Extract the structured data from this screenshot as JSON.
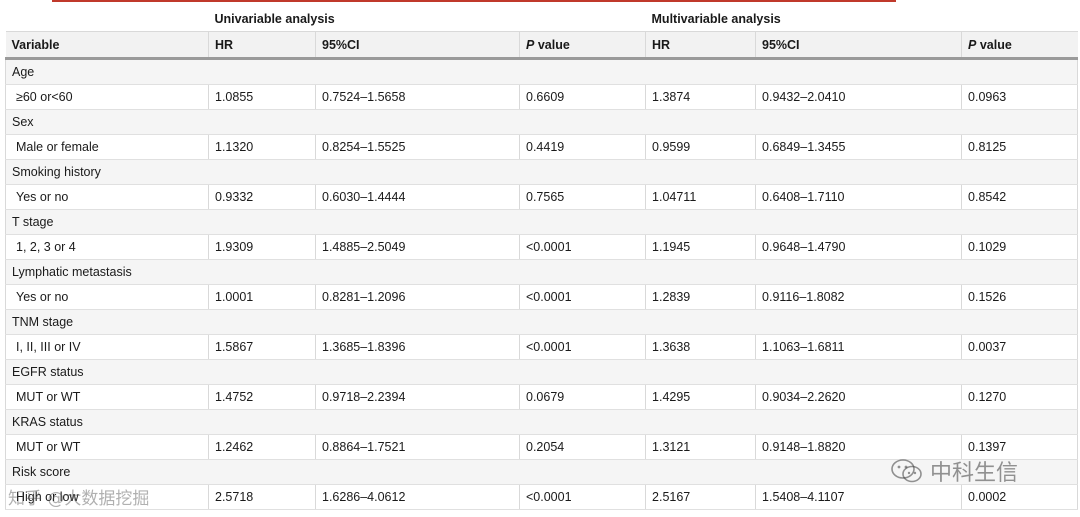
{
  "table": {
    "groups": {
      "univariable": "Univariable analysis",
      "multivariable": "Multivariable analysis"
    },
    "columns": {
      "variable": "Variable",
      "hr1": "HR",
      "ci1": "95%CI",
      "p1": "value",
      "hr2": "HR",
      "ci2": "95%CI",
      "p2": "value",
      "p_italic": "P"
    },
    "rows": [
      {
        "variable": "Age",
        "level": "≥60 or<60",
        "uni_hr": "1.0855",
        "uni_ci": "0.7524–1.5658",
        "uni_p": "0.6609",
        "multi_hr": "1.3874",
        "multi_ci": "0.9432–2.0410",
        "multi_p": "0.0963"
      },
      {
        "variable": "Sex",
        "level": "Male or female",
        "uni_hr": "1.1320",
        "uni_ci": "0.8254–1.5525",
        "uni_p": "0.4419",
        "multi_hr": "0.9599",
        "multi_ci": "0.6849–1.3455",
        "multi_p": "0.8125"
      },
      {
        "variable": "Smoking history",
        "level": "Yes or no",
        "uni_hr": "0.9332",
        "uni_ci": "0.6030–1.4444",
        "uni_p": "0.7565",
        "multi_hr": "1.04711",
        "multi_ci": "0.6408–1.7110",
        "multi_p": "0.8542"
      },
      {
        "variable": "T stage",
        "level": "1, 2, 3 or 4",
        "uni_hr": "1.9309",
        "uni_ci": "1.4885–2.5049",
        "uni_p": "<0.0001",
        "multi_hr": "1.1945",
        "multi_ci": "0.9648–1.4790",
        "multi_p": "0.1029"
      },
      {
        "variable": "Lymphatic metastasis",
        "level": "Yes or no",
        "uni_hr": "1.0001",
        "uni_ci": "0.8281–1.2096",
        "uni_p": "<0.0001",
        "multi_hr": "1.2839",
        "multi_ci": "0.9116–1.8082",
        "multi_p": "0.1526"
      },
      {
        "variable": "TNM stage",
        "level": "I, II, III or IV",
        "uni_hr": "1.5867",
        "uni_ci": "1.3685–1.8396",
        "uni_p": "<0.0001",
        "multi_hr": "1.3638",
        "multi_ci": "1.1063–1.6811",
        "multi_p": "0.0037"
      },
      {
        "variable": "EGFR status",
        "level": "MUT or WT",
        "uni_hr": "1.4752",
        "uni_ci": "0.9718–2.2394",
        "uni_p": "0.0679",
        "multi_hr": "1.4295",
        "multi_ci": "0.9034–2.2620",
        "multi_p": "0.1270"
      },
      {
        "variable": "KRAS status",
        "level": "MUT or WT",
        "uni_hr": "1.2462",
        "uni_ci": "0.8864–1.7521",
        "uni_p": "0.2054",
        "multi_hr": "1.3121",
        "multi_ci": "0.9148–1.8820",
        "multi_p": "0.1397"
      },
      {
        "variable": "Risk score",
        "level": "High or low",
        "uni_hr": "2.5718",
        "uni_ci": "1.6286–4.0612",
        "uni_p": "<0.0001",
        "multi_hr": "2.5167",
        "multi_ci": "1.5408–4.1107",
        "multi_p": "0.0002"
      }
    ]
  },
  "watermarks": {
    "right": "中科生信",
    "left": "知乎 @大数据挖掘"
  },
  "colors": {
    "header_bg": "#f2f2f2",
    "variable_row_bg": "#f5f5f5",
    "top_rule": "#c0392b"
  }
}
